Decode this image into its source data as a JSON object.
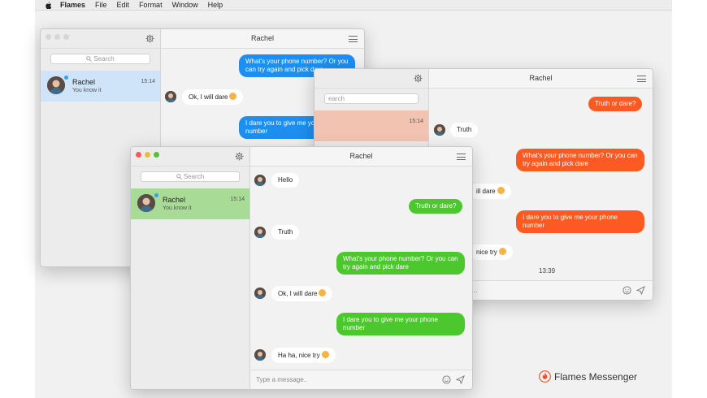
{
  "menubar": {
    "app": "Flames",
    "items": [
      "File",
      "Edit",
      "Format",
      "Window",
      "Help"
    ]
  },
  "search": {
    "placeholder": "Search"
  },
  "contact": {
    "name": "Rachel",
    "preview": "You know it",
    "time": "15:14"
  },
  "back_window": {
    "title": "Rachel",
    "messages": [
      {
        "from": "me",
        "text": "What's your phone number? Or you can try again and pick dare"
      },
      {
        "from": "them",
        "text": "Ok, I will dare"
      },
      {
        "from": "me",
        "text": "I dare you to give me your phone number"
      }
    ]
  },
  "mid_window": {
    "title": "Rachel",
    "messages": [
      {
        "from": "me",
        "text": "Truth or dare?"
      },
      {
        "from": "them",
        "text": "Truth"
      },
      {
        "from": "me",
        "text": "What's your phone number? Or you can try again and pick dare"
      },
      {
        "from": "them",
        "text": "ill dare"
      },
      {
        "from": "me",
        "text": "I dare you to give me your phone number"
      },
      {
        "from": "them",
        "text": "nice try"
      }
    ],
    "timestamp": "13:39",
    "search_partial": "earch",
    "composer_partial": "ge..."
  },
  "front_window": {
    "title": "Rachel",
    "messages": [
      {
        "from": "them",
        "text": "Hello"
      },
      {
        "from": "me",
        "text": "Truth or dare?"
      },
      {
        "from": "them",
        "text": "Truth"
      },
      {
        "from": "me",
        "text": "What's your phone number? Or you can try again and pick dare"
      },
      {
        "from": "them",
        "text": "Ok, I will dare"
      },
      {
        "from": "me",
        "text": "I dare you to give me your phone number"
      },
      {
        "from": "them",
        "text": "Ha ha, nice try"
      }
    ],
    "composer_placeholder": "Type a message.."
  },
  "branding": {
    "text": "Flames Messenger"
  },
  "colors": {
    "blue": "#1d8ff0",
    "green": "#4cc72e",
    "orange": "#fb5b22",
    "selected_blue": "#cfe4f8",
    "selected_green": "#a8dc96",
    "selected_orange": "#f3c3b2"
  },
  "icons": [
    "apple-icon",
    "gear-icon",
    "menu-icon",
    "search-icon",
    "smile-icon",
    "send-icon",
    "flame-logo-icon"
  ]
}
